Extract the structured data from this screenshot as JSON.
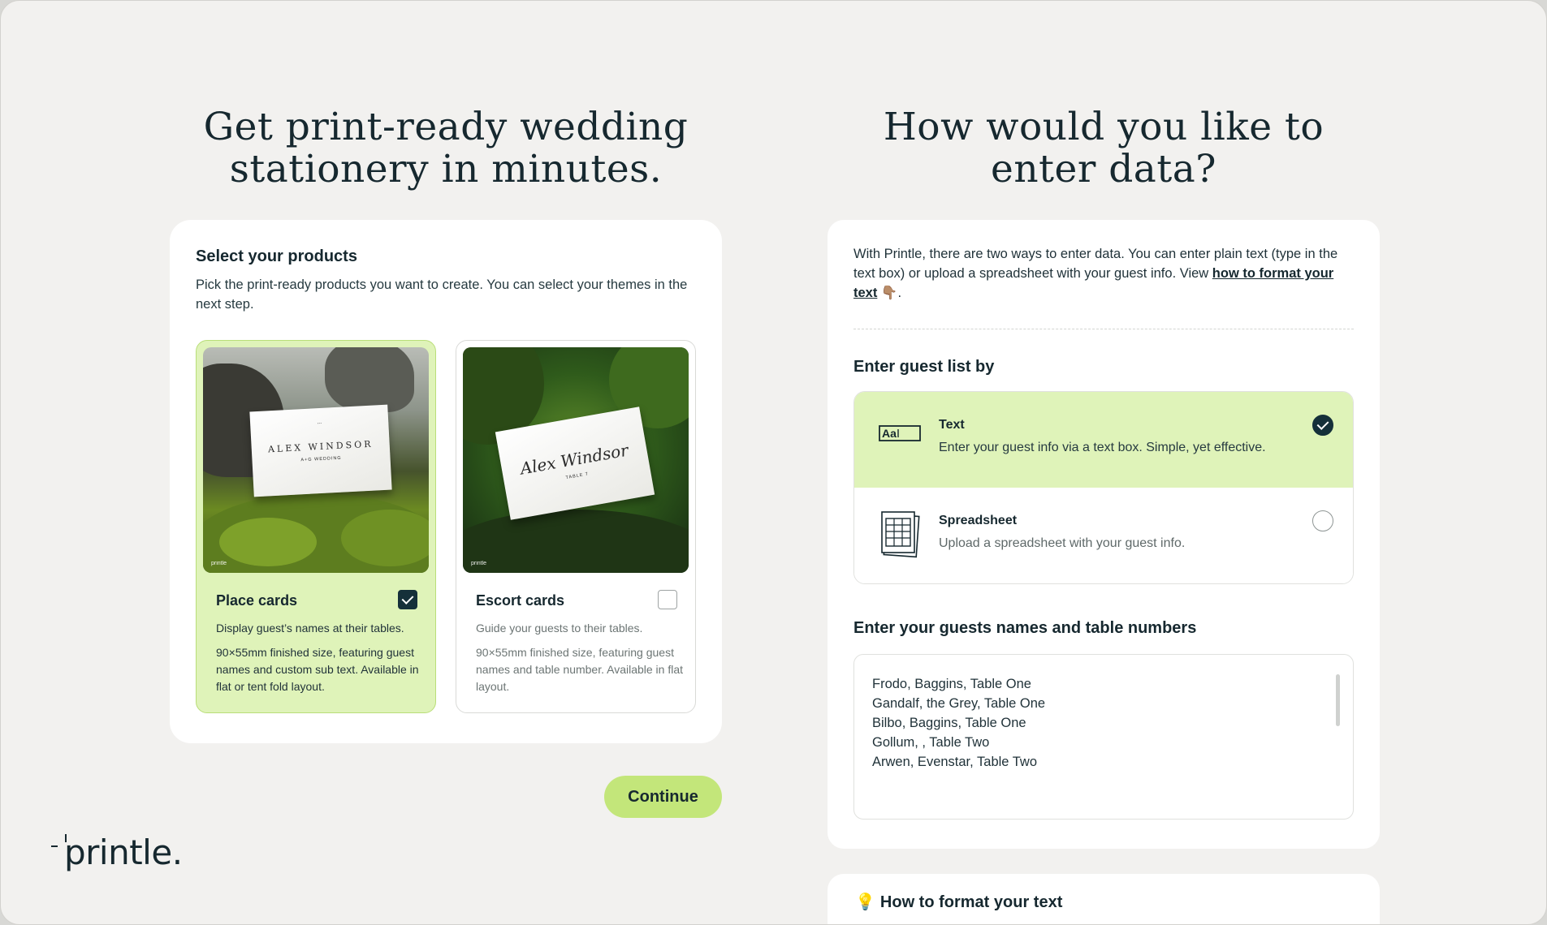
{
  "left": {
    "headline": "Get print-ready wedding stationery in minutes.",
    "products": {
      "title": "Select your products",
      "subtitle": "Pick the print-ready products you want to create. You can select your themes in the next step.",
      "items": [
        {
          "name": "Place cards",
          "selected": true,
          "description": "Display guest’s names at their tables.",
          "spec": "90×55mm finished size, featuring guest names and custom sub text. Available in flat or tent fold layout.",
          "card_name": "ALEX WINDSOR",
          "card_sub": "A+G WEDDING",
          "card_top": "...",
          "watermark": "printle"
        },
        {
          "name": "Escort cards",
          "selected": false,
          "description": "Guide your guests to their tables.",
          "spec": "90×55mm finished size, featuring guest names and table number. Available in flat layout.",
          "card_name": "Alex Windsor",
          "card_sub": "TABLE 7",
          "watermark": "printle"
        }
      ]
    },
    "continue_label": "Continue",
    "logo": "printle."
  },
  "right": {
    "headline": "How would you like to enter data?",
    "intro_prefix": "With Printle, there are two ways to enter data. You can enter plain text (type in the text box) or upload a spreadsheet with your guest info. View ",
    "intro_link": "how to format your text",
    "intro_suffix": " 👇🏽.",
    "entry_method_title": "Enter guest list by",
    "options": [
      {
        "title": "Text",
        "description": "Enter your guest info via a text box. Simple, yet effective.",
        "selected": true,
        "icon": "text-field-icon",
        "icon_text": "Aa"
      },
      {
        "title": "Spreadsheet",
        "description": "Upload a spreadsheet with your guest info.",
        "selected": false,
        "icon": "spreadsheet-icon"
      }
    ],
    "guests_title": "Enter your guests names and table numbers",
    "guests_text": [
      "Frodo, Baggins, Table One",
      "Gandalf, the Grey, Table One",
      "Bilbo, Baggins, Table One",
      "Gollum, , Table Two",
      "Arwen, Evenstar, Table Two"
    ],
    "format_title": "How to format your text",
    "format_icon": "lightbulb-icon"
  },
  "colors": {
    "accent_green": "#c3e67a",
    "selected_bg": "#dff3b9",
    "dark": "#15303a",
    "page_bg": "#f2f1ef"
  }
}
